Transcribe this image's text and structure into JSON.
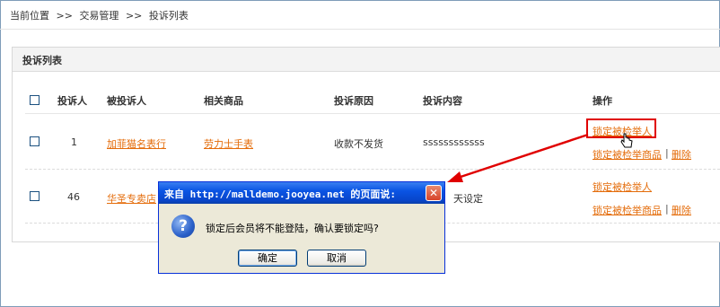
{
  "breadcrumb": {
    "location_label": "当前位置",
    "sep1": ">>",
    "level1": "交易管理",
    "sep2": ">>",
    "level2": "投诉列表"
  },
  "panel": {
    "title": "投诉列表"
  },
  "table": {
    "headers": {
      "complainant": "投诉人",
      "respondent": "被投诉人",
      "product": "相关商品",
      "reason": "投诉原因",
      "content": "投诉内容",
      "actions": "操作"
    },
    "rows": [
      {
        "complainant": "1",
        "respondent": "加菲猫名表行",
        "product": "劳力士手表",
        "reason": "收款不发货",
        "content": "ssssssssssss",
        "action_lock": "锁定被检举人",
        "action_lock_product": "锁定被检举商品",
        "separator": "|",
        "action_delete": "删除"
      },
      {
        "complainant": "46",
        "respondent": "华圣专卖店",
        "product": "",
        "reason": "",
        "content": "天设定",
        "action_lock": "锁定被检举人",
        "action_lock_product": "锁定被检举商品",
        "separator": "|",
        "action_delete": "删除"
      }
    ]
  },
  "dialog": {
    "title": "来自 http://malldemo.jooyea.net 的页面说:",
    "close_glyph": "✕",
    "icon_glyph": "?",
    "message": "锁定后会员将不能登陆，确认要锁定吗?",
    "ok_label": "确定",
    "cancel_label": "取消"
  },
  "colors": {
    "link": "#e46c0a",
    "annotation_red": "#e00000",
    "dialog_title_blue": "#0a54e4",
    "dialog_body": "#ece9d8"
  },
  "icons": {
    "dialog_close": "close-icon",
    "dialog_question": "question-icon",
    "cursor": "hand-cursor-icon"
  }
}
